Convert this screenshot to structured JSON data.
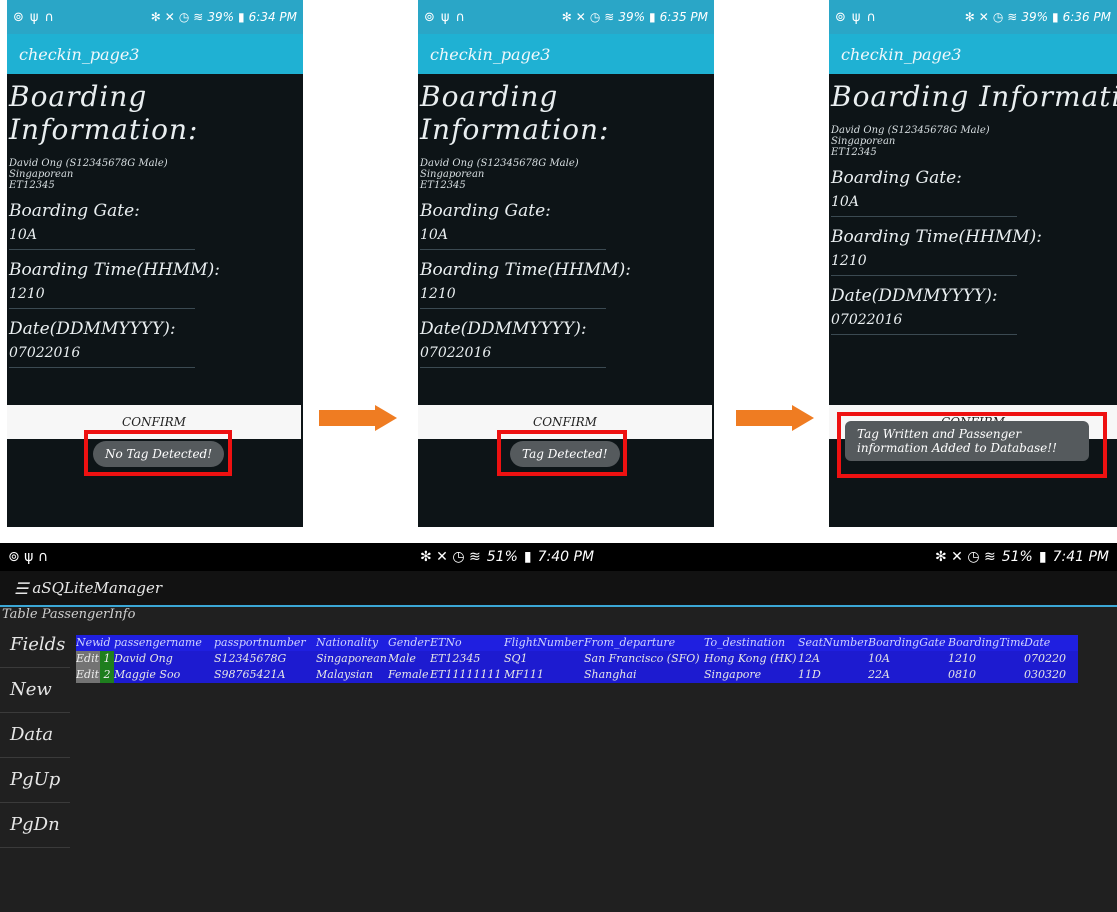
{
  "phones": [
    {
      "time": "6:34 PM",
      "title": "checkin_page3",
      "heading": "Boarding Information:",
      "passenger_lines": [
        "David Ong (S12345678G Male)",
        "Singaporean",
        "ET12345"
      ],
      "gate_label": "Boarding Gate:",
      "gate_value": "10A",
      "time_label": "Boarding Time(HHMM):",
      "time_value": "1210",
      "date_label": "Date(DDMMYYYY):",
      "date_value": "07022016",
      "confirm_label": "CONFIRM",
      "toast": "No Tag Detected!"
    },
    {
      "time": "6:35 PM",
      "title": "checkin_page3",
      "heading": "Boarding Information:",
      "passenger_lines": [
        "David Ong (S12345678G Male)",
        "Singaporean",
        "ET12345"
      ],
      "gate_label": "Boarding Gate:",
      "gate_value": "10A",
      "time_label": "Boarding Time(HHMM):",
      "time_value": "1210",
      "date_label": "Date(DDMMYYYY):",
      "date_value": "07022016",
      "confirm_label": "CONFIRM",
      "toast": "Tag Detected!"
    },
    {
      "time": "6:36 PM",
      "title": "checkin_page3",
      "heading": "Boarding Information:",
      "passenger_lines": [
        "David Ong (S12345678G Male)",
        "Singaporean",
        "ET12345"
      ],
      "gate_label": "Boarding Gate:",
      "gate_value": "10A",
      "time_label": "Boarding Time(HHMM):",
      "time_value": "1210",
      "date_label": "Date(DDMMYYYY):",
      "date_value": "07022016",
      "confirm_label": "CONFIRM",
      "toast": "Tag Written and Passenger information Added to Database!!"
    }
  ],
  "battery_top": "39%",
  "db": {
    "time_left": "7:40 PM",
    "time_right": "7:41 PM",
    "battery": "51%",
    "app_name": "aSQLiteManager",
    "table_title": "Table PassengerInfo",
    "side_buttons": [
      "Fields",
      "New",
      "Data",
      "PgUp",
      "PgDn"
    ],
    "columns": [
      "New",
      "id",
      "passengername",
      "passportnumber",
      "Nationality",
      "Gender",
      "ETNo",
      "FlightNumber",
      "From_departure",
      "To_destination",
      "SeatNumber",
      "BoardingGate",
      "BoardingTime",
      "Date"
    ],
    "rows": [
      [
        "Edit",
        "1",
        "David Ong",
        "S12345678G",
        "Singaporean",
        "Male",
        "ET12345",
        "SQ1",
        "San Francisco (SFO)",
        "Hong Kong (HK)",
        "12A",
        "10A",
        "1210",
        "070220"
      ],
      [
        "Edit",
        "2",
        "Maggie Soo",
        "S98765421A",
        "Malaysian",
        "Female",
        "ET11111111",
        "MF111",
        "Shanghai",
        "Singapore",
        "11D",
        "22A",
        "0810",
        "030320"
      ]
    ]
  },
  "colors": {
    "appbar": "#1fb1d3",
    "toast_box": "#ee1111",
    "arrow": "#ef7c22",
    "grid": "#1d1bd0"
  }
}
